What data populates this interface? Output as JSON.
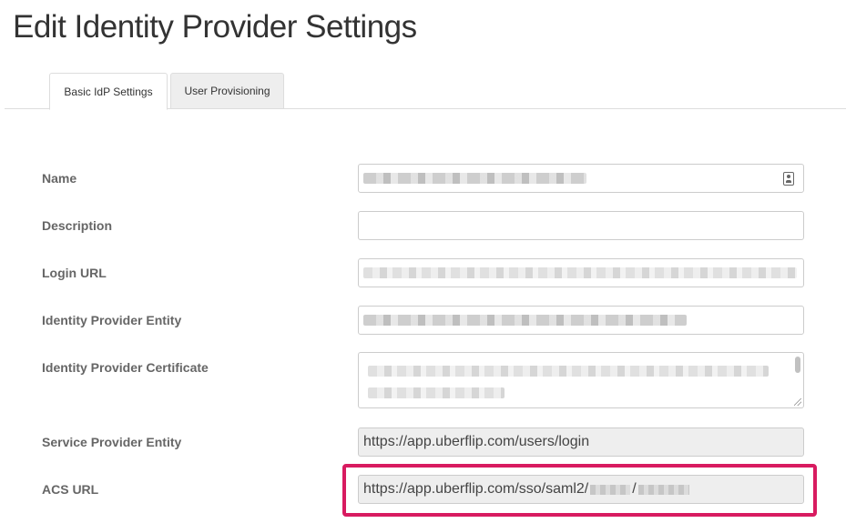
{
  "page": {
    "title": "Edit Identity Provider Settings"
  },
  "tabs": [
    {
      "label": "Basic IdP Settings",
      "active": true
    },
    {
      "label": "User Provisioning",
      "active": false
    }
  ],
  "form": {
    "name": {
      "label": "Name"
    },
    "description": {
      "label": "Description",
      "value": ""
    },
    "login_url": {
      "label": "Login URL"
    },
    "idp_entity": {
      "label": "Identity Provider Entity"
    },
    "idp_certificate": {
      "label": "Identity Provider Certificate"
    },
    "sp_entity": {
      "label": "Service Provider Entity",
      "value": "https://app.uberflip.com/users/login"
    },
    "acs_url": {
      "label": "ACS URL",
      "value_prefix": "https://app.uberflip.com/sso/saml2/",
      "separator": "/"
    }
  },
  "icons": {
    "name_field": "contact-card-icon"
  },
  "colors": {
    "highlight": "#d81b60",
    "readonly_bg": "#eeeeee"
  }
}
